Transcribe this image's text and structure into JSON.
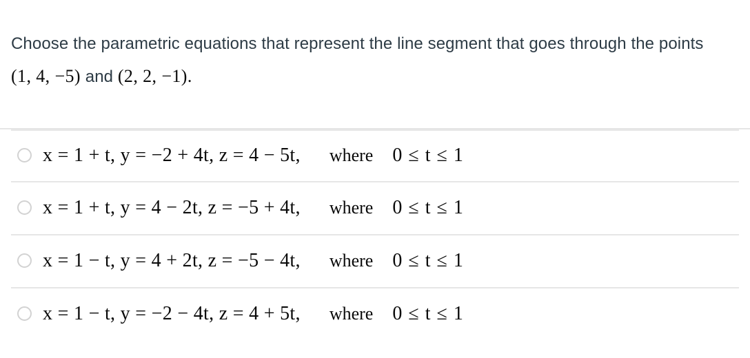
{
  "question": {
    "line1_part1": "Choose the parametric equations that represent the line segment that goes",
    "line2_part1": "through the points ",
    "point_a": "(1, 4, −5)",
    "conjunction": " and ",
    "point_b": "(2, 2, −1)",
    "period": "."
  },
  "answers": [
    {
      "id": "option-1",
      "equations": "x = 1 + t,  y = −2 + 4t,  z = 4 − 5t,",
      "where_label": "where",
      "condition": "0 ≤ t ≤ 1",
      "selected": false
    },
    {
      "id": "option-2",
      "equations": "x = 1 + t,  y = 4 − 2t,  z = −5 + 4t,",
      "where_label": "where",
      "condition": "0 ≤ t ≤ 1",
      "selected": false
    },
    {
      "id": "option-3",
      "equations": "x = 1 − t,  y = 4 + 2t,  z = −5 − 4t,",
      "where_label": "where",
      "condition": "0 ≤ t ≤ 1",
      "selected": false
    },
    {
      "id": "option-4",
      "equations": "x = 1 − t,  y = −2 − 4t,  z = 4 + 5t,",
      "where_label": "where",
      "condition": "0 ≤ t ≤ 1",
      "selected": false
    }
  ],
  "colors": {
    "prompt_text": "#2d3b45",
    "math_text": "#0a0a0a",
    "divider": "#e6e6e6",
    "radio_border": "#d2d2d2",
    "background": "#ffffff"
  }
}
